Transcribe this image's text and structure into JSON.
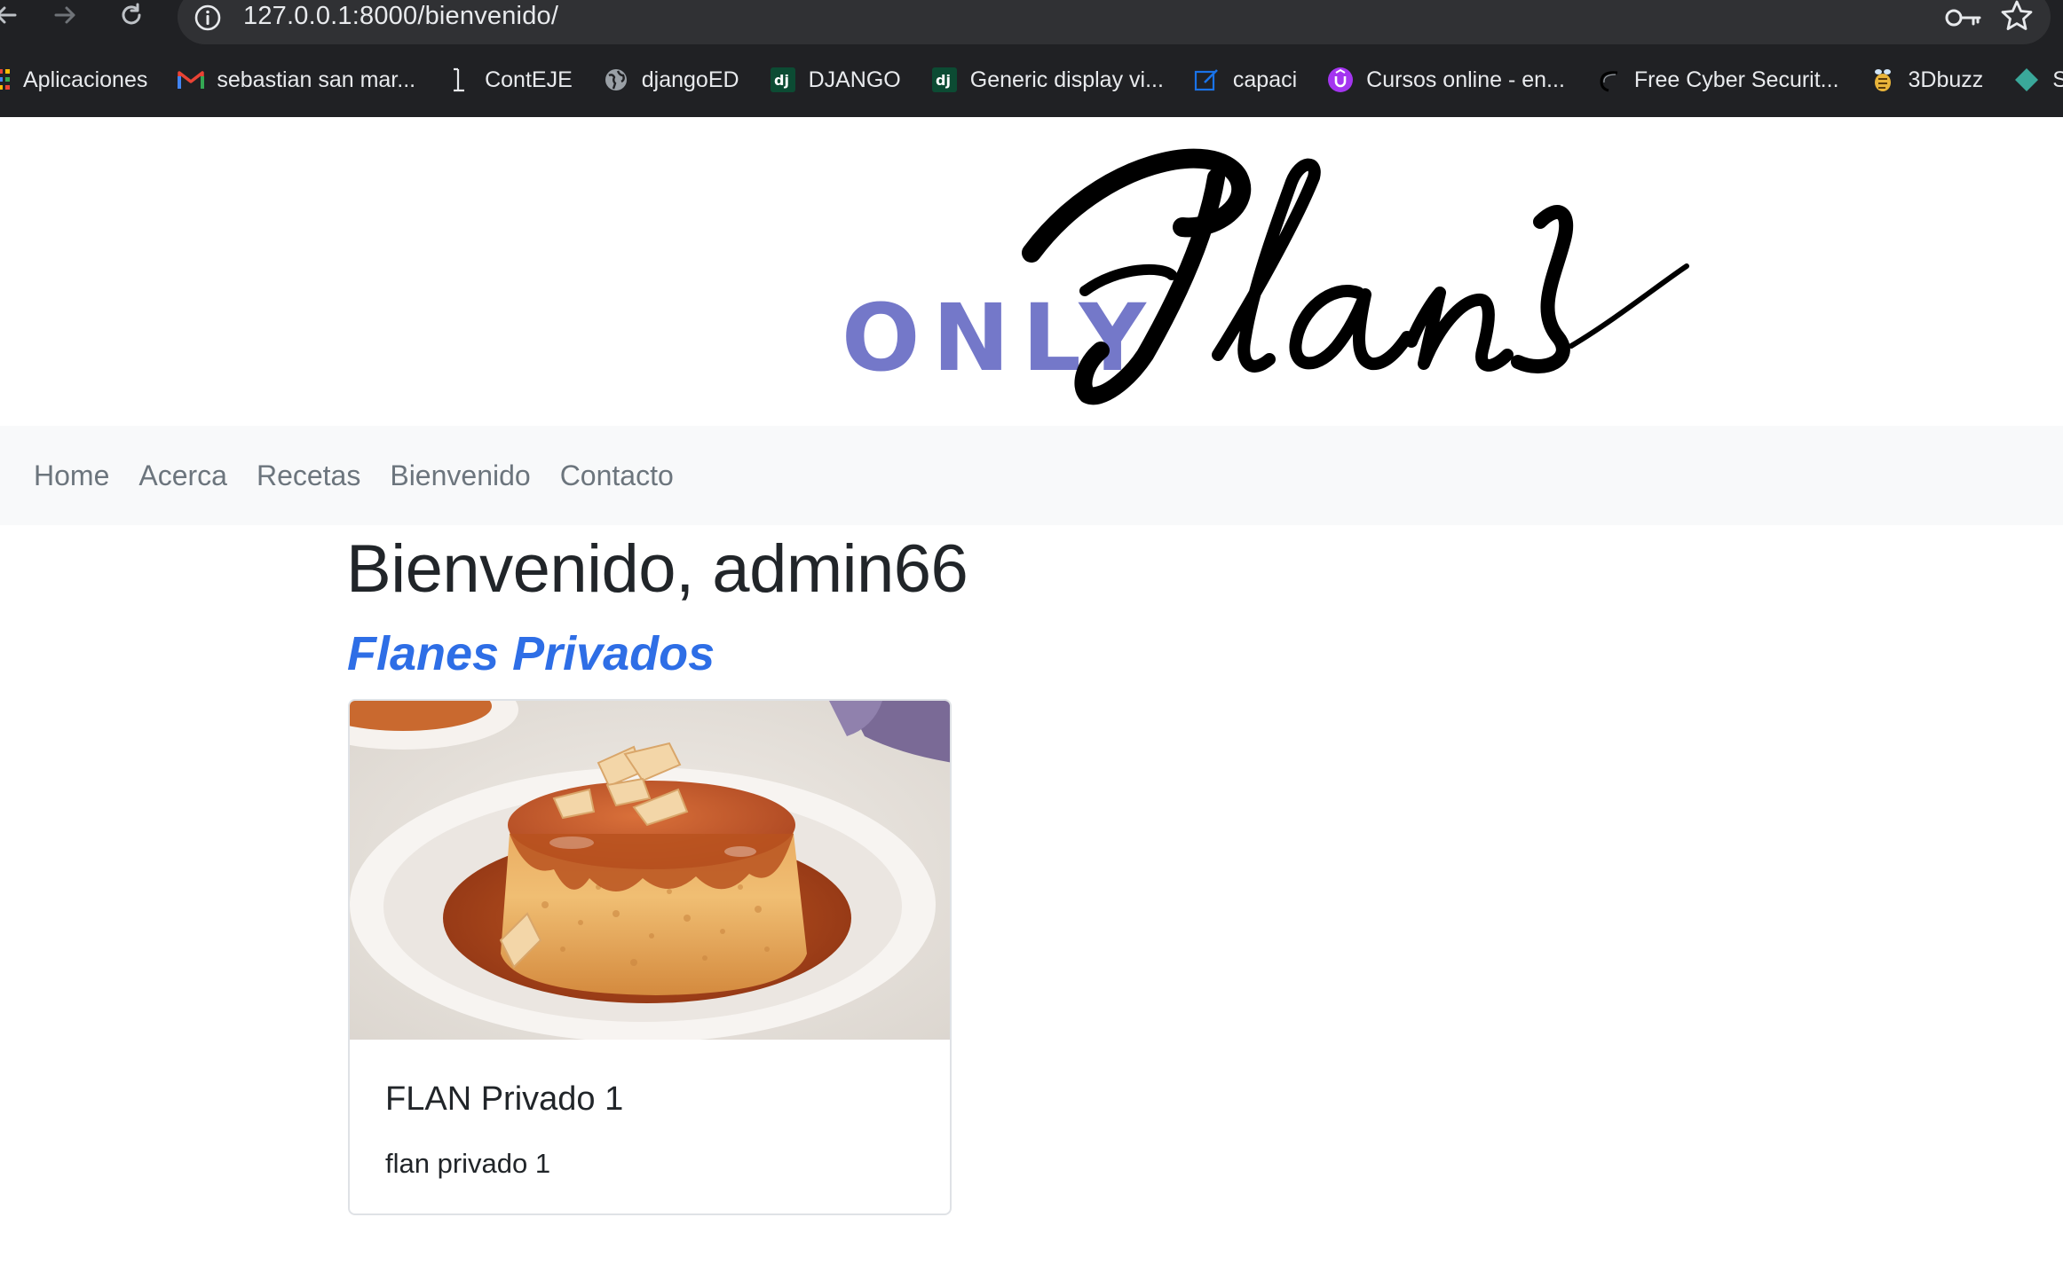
{
  "browser": {
    "url": "127.0.0.1:8000/bienvenido/",
    "bookmarks": [
      {
        "label": "Aplicaciones",
        "icon": "apps-grid-icon"
      },
      {
        "label": "sebastian san mar...",
        "icon": "gmail-icon"
      },
      {
        "label": "ContEJE",
        "icon": "text-cursor-icon"
      },
      {
        "label": "djangoED",
        "icon": "globe-icon"
      },
      {
        "label": "DJANGO",
        "icon": "django-icon"
      },
      {
        "label": "Generic display vi...",
        "icon": "django-icon"
      },
      {
        "label": "capaci",
        "icon": "edit-icon"
      },
      {
        "label": "Cursos online - en...",
        "icon": "udemy-icon"
      },
      {
        "label": "Free Cyber Securit...",
        "icon": "swoosh-icon"
      },
      {
        "label": "3Dbuzz",
        "icon": "3dbuzz-icon"
      },
      {
        "label": "S",
        "icon": "diamond-icon"
      }
    ]
  },
  "header": {
    "logo_small": "ONLY",
    "logo_script": "Flans"
  },
  "navbar": {
    "links": [
      "Home",
      "Acerca",
      "Recetas",
      "Bienvenido",
      "Contacto"
    ]
  },
  "main": {
    "welcome": "Bienvenido, admin66",
    "section_title": "Flanes Privados",
    "cards": [
      {
        "title": "FLAN Privado 1",
        "text": "flan privado 1",
        "image": "flan-image"
      }
    ]
  },
  "colors": {
    "logo_only": "#7478c9",
    "section_title": "#2e6ee6",
    "navbar_bg": "#f8f9fa",
    "chrome_bg": "#202124"
  }
}
